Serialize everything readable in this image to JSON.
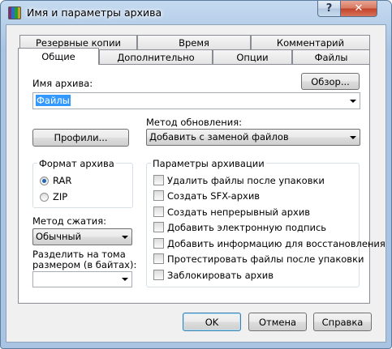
{
  "window": {
    "title": "Имя и параметры архива"
  },
  "tabs_back": [
    "Резервные копии",
    "Время",
    "Комментарий"
  ],
  "tabs_front": [
    "Общие",
    "Дополнительно",
    "Опции",
    "Файлы"
  ],
  "general": {
    "archive_name_label": "Имя архива:",
    "browse_button": "Обзор...",
    "archive_name_value": "Файлы",
    "profiles_button": "Профили...",
    "update_method_label": "Метод обновления:",
    "update_method_value": "Добавить с заменой файлов",
    "archive_format": {
      "label": "Формат архива",
      "options": [
        "RAR",
        "ZIP"
      ],
      "selected": "RAR"
    },
    "compression": {
      "label": "Метод сжатия:",
      "value": "Обычный"
    },
    "split": {
      "label_line1": "Разделить на тома",
      "label_line2": "размером (в байтах):",
      "value": ""
    },
    "options_group": {
      "label": "Параметры архивации",
      "items": [
        "Удалить файлы после упаковки",
        "Создать SFX-архив",
        "Создать непрерывный архив",
        "Добавить электронную подпись",
        "Добавить информацию для восстановления",
        "Протестировать файлы после упаковки",
        "Заблокировать архив"
      ]
    }
  },
  "footer": {
    "ok": "OK",
    "cancel": "Отмена",
    "help": "Справка"
  },
  "colors": {
    "accent": "#3399ff",
    "close": "#c2422a"
  }
}
